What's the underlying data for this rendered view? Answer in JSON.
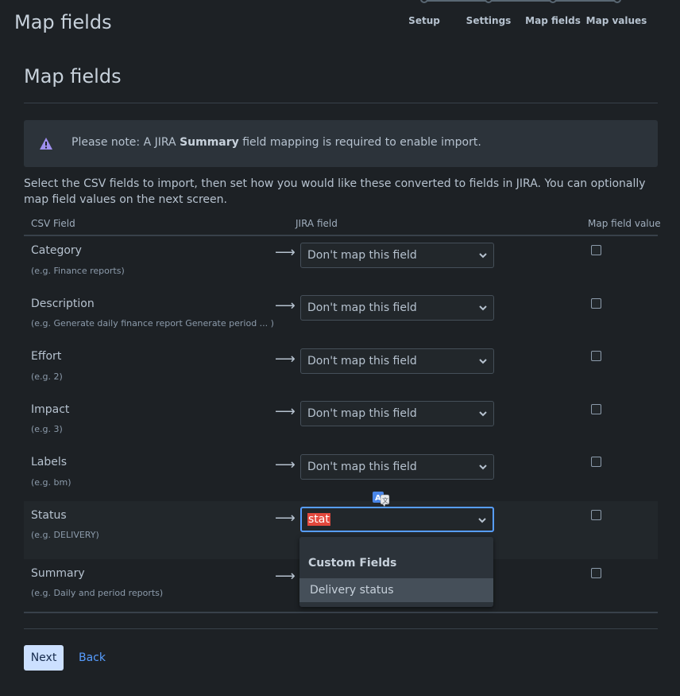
{
  "app_title": "Map fields",
  "stepper": {
    "steps": [
      "Setup",
      "Settings",
      "Map fields",
      "Map values"
    ]
  },
  "page_heading": "Map fields",
  "notice": {
    "prefix": "Please note: A JIRA ",
    "bold": "Summary",
    "suffix": " field mapping is required to enable import."
  },
  "intro": "Select the CSV fields to import, then set how you would like these converted to fields in JIRA. You can optionally map field values on the next screen.",
  "table": {
    "headers": {
      "csv": "CSV Field",
      "jira": "JIRA field",
      "map": "Map field value"
    },
    "arrow": "⟶",
    "rows": [
      {
        "name": "Category",
        "example": "(e.g.  Finance reports)",
        "select": "Don't map this field"
      },
      {
        "name": "Description",
        "example": "(e.g.  Generate daily finance report Generate period ... )",
        "select": "Don't map this field"
      },
      {
        "name": "Effort",
        "example": "(e.g.  2)",
        "select": "Don't map this field"
      },
      {
        "name": "Impact",
        "example": "(e.g.  3)",
        "select": "Don't map this field"
      },
      {
        "name": "Labels",
        "example": "(e.g.  bm)",
        "select": "Don't map this field"
      },
      {
        "name": "Status",
        "example": "(e.g.  DELIVERY)",
        "select": "stat"
      },
      {
        "name": "Summary",
        "example": "(e.g.  Daily and period reports)",
        "select": ""
      }
    ]
  },
  "dropdown": {
    "group": "Custom Fields",
    "option": "Delivery status"
  },
  "buttons": {
    "next": "Next",
    "back": "Back"
  },
  "colors": {
    "accent": "#579dff",
    "highlight_text": "#e2483d",
    "warning": "#9f8fef"
  }
}
